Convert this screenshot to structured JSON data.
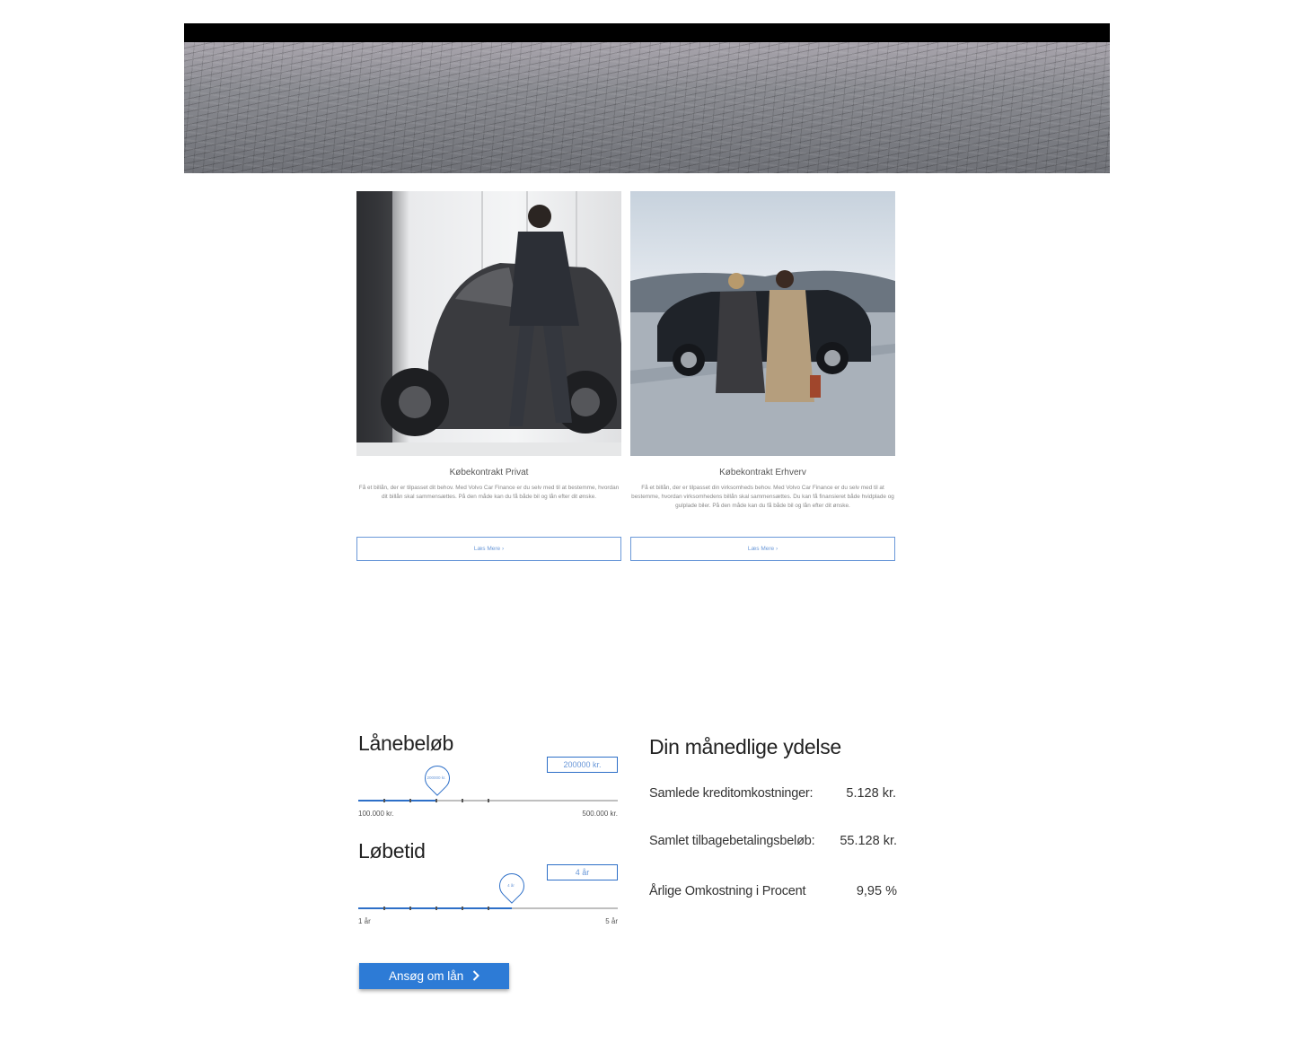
{
  "cards": [
    {
      "title": "Købekontrakt Privat",
      "text": "Få et billån, der er tilpasset dit behov. Med Volvo Car Finance er du selv med til at bestemme, hvordan dit billån skal sammensættes. På den måde kan du få både bil og lån efter dit ønske.",
      "button": "Læs Mere  ›"
    },
    {
      "title": "Købekontrakt Erhverv",
      "text": "Få et billån, der er tilpasset din virksomheds behov. Med Volvo Car Finance er du selv med til at bestemme, hvordan virksomhedens billån skal sammensættes. Du kan få finansieret både hvidplade og gulplade biler. På den måde kan du få både bil og lån efter dit ønske.",
      "button": "Læs Mere  ›"
    }
  ],
  "calculator": {
    "loan": {
      "label": "Lånebeløb",
      "value_box": "200000 kr.",
      "pin_label": "200000 kr.",
      "min_label": "100.000 kr.",
      "max_label": "500.000 kr.",
      "fill_fraction": 0.3
    },
    "term": {
      "label": "Løbetid",
      "value_box": "4 år",
      "pin_label": "4 år",
      "min_label": "1 år",
      "max_label": "5 år",
      "fill_fraction": 0.59
    },
    "apply_button": "Ansøg om lån"
  },
  "results": {
    "title": "Din månedlige ydelse",
    "rows": [
      {
        "label": "Samlede kreditomkostninger:",
        "value": "5.128 kr."
      },
      {
        "label": "Samlet tilbagebetalingsbeløb:",
        "value": "55.128 kr."
      },
      {
        "label": "Årlige Omkostning i Procent",
        "value": "9,95 %"
      }
    ]
  },
  "colors": {
    "accent": "#2d7bd6",
    "link": "#6a98d8"
  }
}
